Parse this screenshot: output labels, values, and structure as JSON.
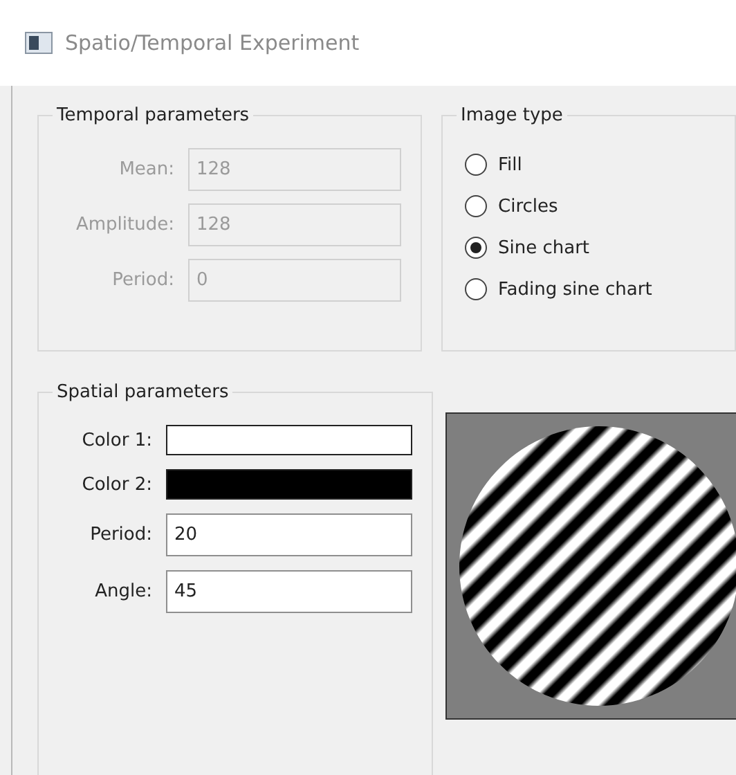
{
  "window": {
    "title": "Spatio/Temporal Experiment"
  },
  "temporal": {
    "title": "Temporal parameters",
    "fields": [
      {
        "label": "Mean:",
        "value": "128",
        "disabled": true
      },
      {
        "label": "Amplitude:",
        "value": "128",
        "disabled": true
      },
      {
        "label": "Period:",
        "value": "0",
        "disabled": true
      }
    ]
  },
  "image_type": {
    "title": "Image type",
    "options": [
      {
        "label": "Fill",
        "selected": false
      },
      {
        "label": "Circles",
        "selected": false
      },
      {
        "label": "Sine chart",
        "selected": true
      },
      {
        "label": "Fading sine chart",
        "selected": false
      }
    ]
  },
  "spatial": {
    "title": "Spatial parameters",
    "fields": [
      {
        "kind": "color",
        "label": "Color 1:",
        "color": "#ffffff"
      },
      {
        "kind": "color",
        "label": "Color 2:",
        "color": "#000000"
      },
      {
        "kind": "text",
        "label": "Period:",
        "value": "20",
        "disabled": false
      },
      {
        "kind": "text",
        "label": "Angle:",
        "value": "45",
        "disabled": false
      }
    ]
  }
}
